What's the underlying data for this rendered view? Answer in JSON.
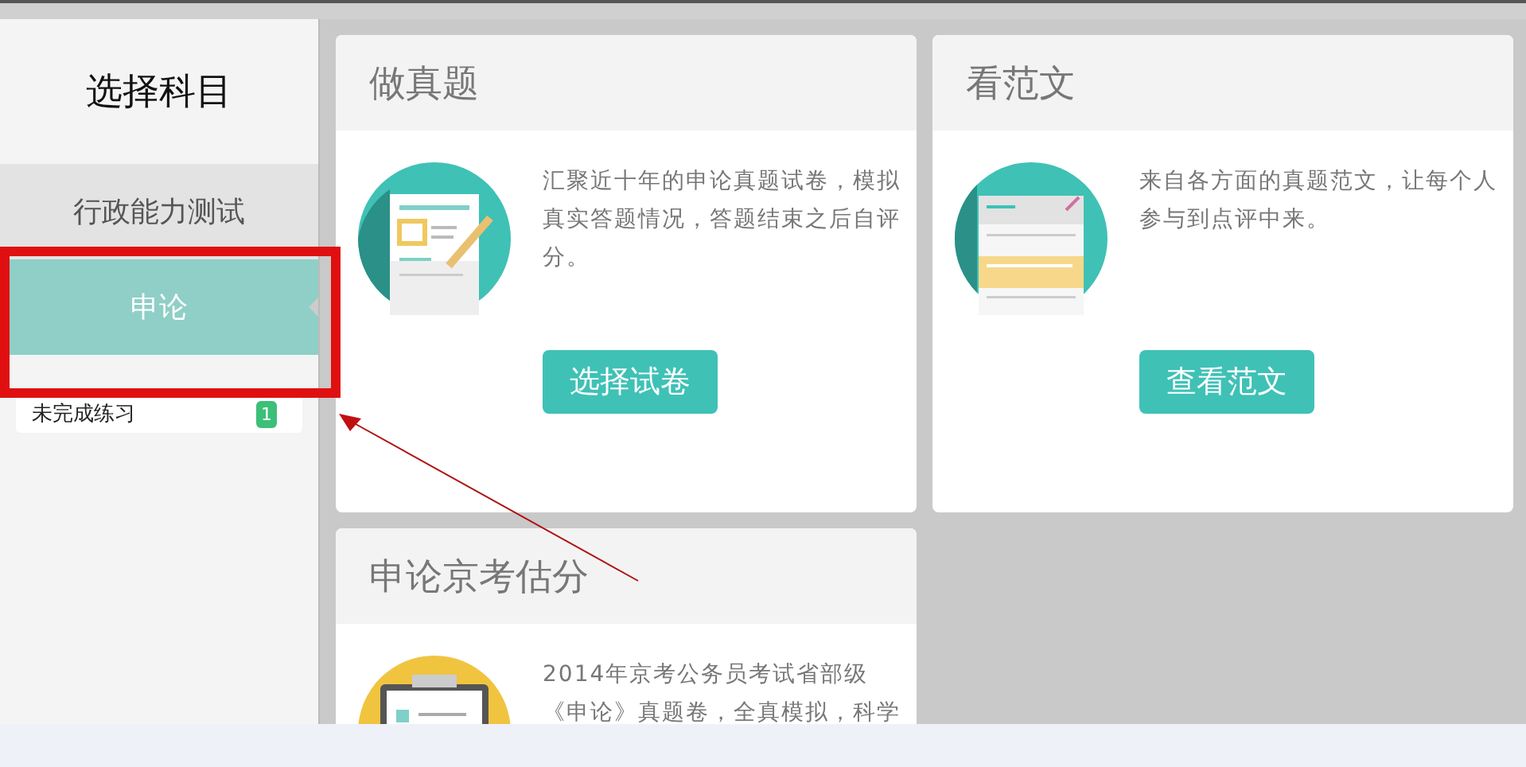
{
  "sidebar": {
    "title": "选择科目",
    "items": [
      {
        "label": "行政能力测试",
        "selected": false
      },
      {
        "label": "申论",
        "selected": true
      }
    ],
    "pending": {
      "label": "未完成练习",
      "badge": "1"
    }
  },
  "cards": [
    {
      "kind": "exam",
      "title": "做真题",
      "description": "汇聚近十年的申论真题试卷，模拟真实答题情况，答题结束之后自评分。",
      "button": "选择试卷"
    },
    {
      "kind": "essay",
      "title": "看范文",
      "description": "来自各方面的真题范文，让每个人参与到点评中来。",
      "button": "查看范文"
    },
    {
      "kind": "score",
      "title": "申论京考估分",
      "description": "2014年京考公务员考试省部级《申论》真题卷，全真模拟，科学"
    }
  ],
  "annotation": {
    "visible": true
  }
}
